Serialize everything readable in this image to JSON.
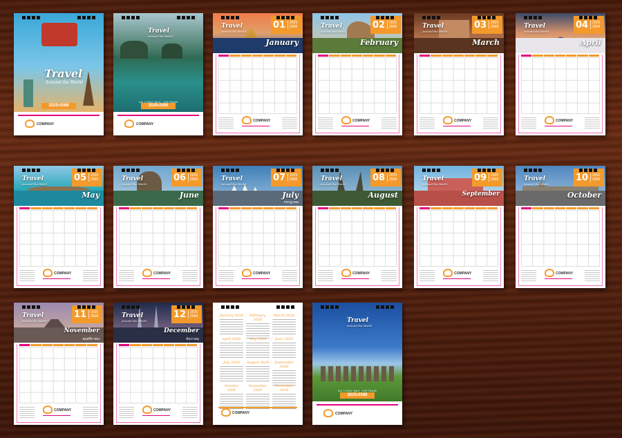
{
  "covers": {
    "front": {
      "title": "Travel",
      "subtitle": "Around the World",
      "year": "2025•2568"
    },
    "inside": {
      "title": "Travel",
      "subtitle": "Around the World",
      "caption": "HA LONG BAY, VIETNAM",
      "year": "2025•2568"
    },
    "back": {
      "title": "Travel",
      "subtitle": "Around the World",
      "caption": "HA LONG BAY, VIETNAM",
      "year": "2025•2568"
    }
  },
  "company": {
    "name": "COMPANY"
  },
  "brand": {
    "title": "Travel",
    "subtitle": "Around the World"
  },
  "year_labels": [
    "2025",
    "2568"
  ],
  "months": [
    {
      "num": "01",
      "name": "January",
      "thai": ""
    },
    {
      "num": "02",
      "name": "February",
      "thai": ""
    },
    {
      "num": "03",
      "name": "March",
      "thai": ""
    },
    {
      "num": "04",
      "name": "April",
      "thai": ""
    },
    {
      "num": "05",
      "name": "May",
      "thai": ""
    },
    {
      "num": "06",
      "name": "June",
      "thai": ""
    },
    {
      "num": "07",
      "name": "July",
      "thai": "กรกฎาคม"
    },
    {
      "num": "08",
      "name": "August",
      "thai": ""
    },
    {
      "num": "09",
      "name": "September",
      "thai": ""
    },
    {
      "num": "10",
      "name": "October",
      "thai": ""
    },
    {
      "num": "11",
      "name": "November",
      "thai": "พฤศจิกายน"
    },
    {
      "num": "12",
      "name": "December",
      "thai": "ธันวาคม"
    }
  ],
  "year_overview": {
    "months": [
      "January 2026",
      "February 2026",
      "March 2026",
      "April 2026",
      "May 2026",
      "June 2026",
      "July 2026",
      "August 2026",
      "September 2026",
      "October 2026",
      "November 2026",
      "December 2026"
    ]
  },
  "colors": {
    "accent": "#f39a2b",
    "pink": "#e4007c"
  }
}
